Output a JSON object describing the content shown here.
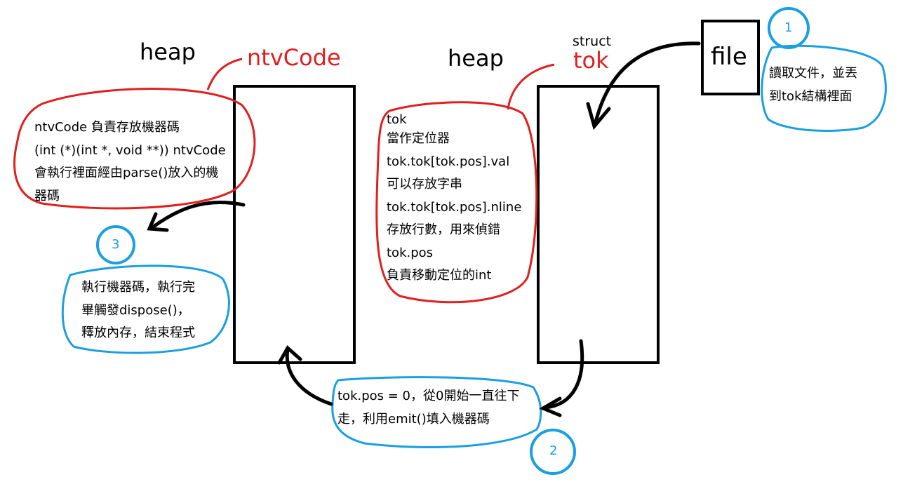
{
  "left_block": {
    "heap_label": "heap",
    "name_label": "ntvCode",
    "description": [
      "ntvCode 負責存放機器碼",
      "(int (*)(int *, void **)) ntvCode",
      "會執行裡面經由parse()放入的機",
      "器碼"
    ]
  },
  "right_block": {
    "heap_label": "heap",
    "struct_label": "struct",
    "name_label": "tok",
    "description": [
      "tok",
      "當作定位器",
      "tok.tok[tok.pos].val",
      "可以存放字串",
      "tok.tok[tok.pos].nline",
      "存放行數，用來偵錯",
      "tok.pos",
      "負責移動定位的int"
    ]
  },
  "file_box": {
    "label": "file"
  },
  "steps": [
    {
      "number": "1",
      "lines": [
        "讀取文件，並丟",
        "到tok結構裡面"
      ]
    },
    {
      "number": "2",
      "lines": [
        "tok.pos = 0，從0開始一直往下",
        "走，利用emit()填入機器碼"
      ]
    },
    {
      "number": "3",
      "lines": [
        "執行機器碼，執行完",
        "畢觸發dispose()，",
        "釋放內存，結束程式"
      ]
    }
  ],
  "colors": {
    "red": "#e02020",
    "blue": "#1a9fe0",
    "black": "#000000"
  }
}
